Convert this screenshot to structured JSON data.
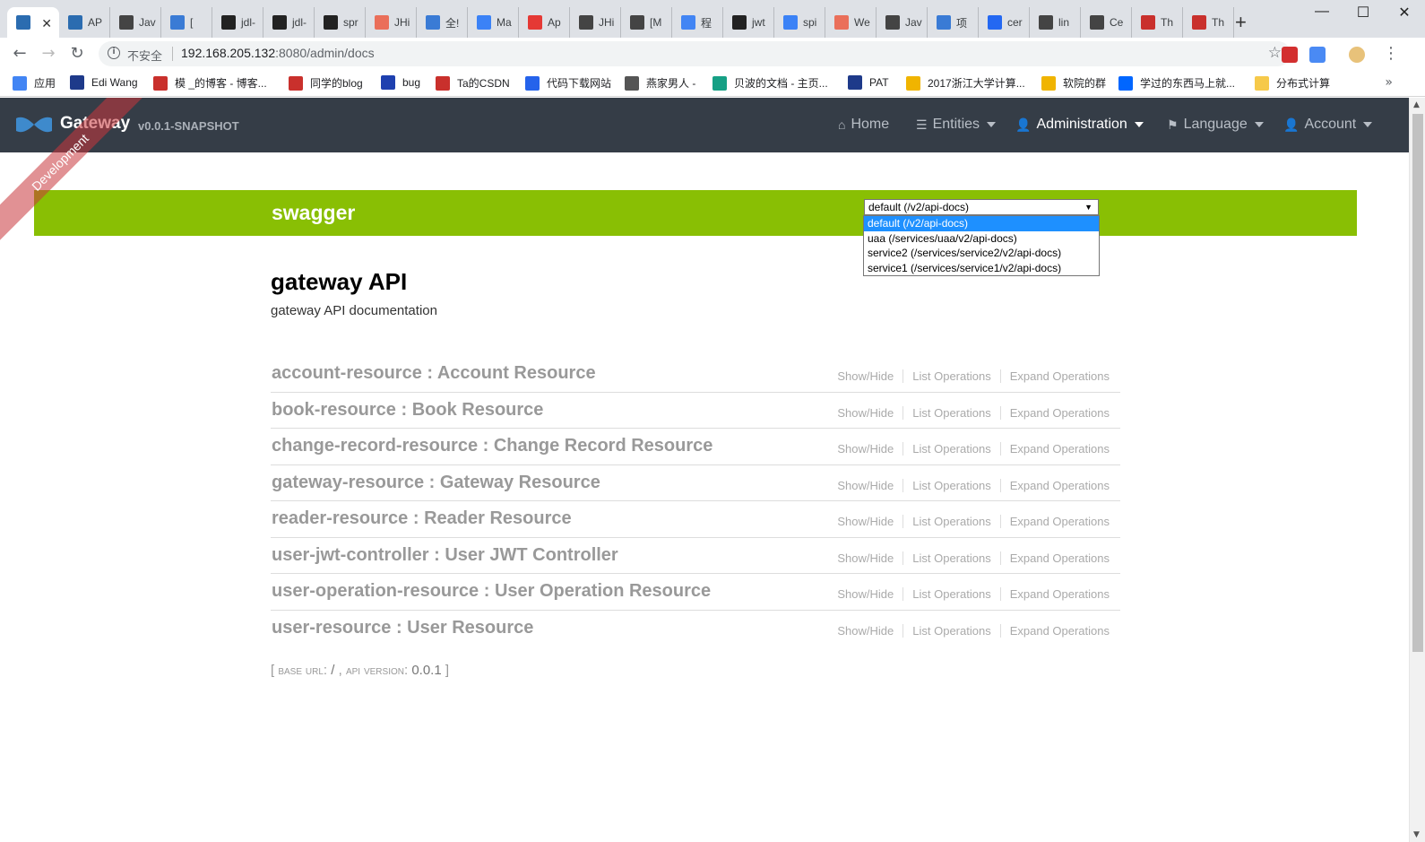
{
  "browser": {
    "tabs": [
      {
        "title": "",
        "favicon": "jhipster-icon",
        "color": "#2b6cb0",
        "active": true
      },
      {
        "title": "AP",
        "favicon": "jhipster-icon",
        "color": "#2b6cb0"
      },
      {
        "title": "Jav",
        "favicon": "tophat-icon",
        "color": "#444444"
      },
      {
        "title": "[",
        "favicon": "square-icon",
        "color": "#3a7bd5"
      },
      {
        "title": "jdl-",
        "favicon": "github-icon",
        "color": "#222222"
      },
      {
        "title": "jdl-",
        "favicon": "github-icon",
        "color": "#222222"
      },
      {
        "title": "spr",
        "favicon": "github-icon",
        "color": "#222222"
      },
      {
        "title": "JHi",
        "favicon": "jianshu-icon",
        "color": "#ea6f5a"
      },
      {
        "title": "全!",
        "favicon": "square-icon",
        "color": "#3a7bd5"
      },
      {
        "title": "Ma",
        "favicon": "stack-icon",
        "color": "#3b82f6"
      },
      {
        "title": "Ap",
        "favicon": "owl-icon",
        "color": "#e53935"
      },
      {
        "title": "JHi",
        "favicon": "tophat-icon",
        "color": "#444444"
      },
      {
        "title": "[M",
        "favicon": "tophat-icon",
        "color": "#444444"
      },
      {
        "title": "程",
        "favicon": "google-icon",
        "color": "#4285f4"
      },
      {
        "title": "jwt",
        "favicon": "github-icon",
        "color": "#222222"
      },
      {
        "title": "spi",
        "favicon": "stack-icon",
        "color": "#3b82f6"
      },
      {
        "title": "We",
        "favicon": "jianshu-icon",
        "color": "#ea6f5a"
      },
      {
        "title": "Jav",
        "favicon": "tophat-icon",
        "color": "#444444"
      },
      {
        "title": "项",
        "favicon": "square-icon",
        "color": "#3a7bd5"
      },
      {
        "title": "cer",
        "favicon": "paw-icon",
        "color": "#2468f2"
      },
      {
        "title": "lin",
        "favicon": "tophat-icon",
        "color": "#444444"
      },
      {
        "title": "Ce",
        "favicon": "tophat-icon",
        "color": "#444444"
      },
      {
        "title": "Th",
        "favicon": "csdn-icon",
        "color": "#c9302c"
      },
      {
        "title": "Th",
        "favicon": "csdn-icon",
        "color": "#c9302c"
      }
    ],
    "new_tab": "+",
    "window_controls": {
      "minimize": "—",
      "maximize": "☐",
      "close": "✕"
    },
    "address": {
      "security_label": "不安全",
      "url_host": "192.168.205.132",
      "url_rest": ":8080/admin/docs"
    },
    "bookmarks": [
      {
        "label": "应用",
        "icon": "apps-grid-icon",
        "color": "#4285f4"
      },
      {
        "label": "Edi Wang",
        "icon": "edi-icon",
        "color": "#1e3a8a"
      },
      {
        "label": "模 _的博客 - 博客...",
        "icon": "csdn-icon",
        "color": "#c9302c"
      },
      {
        "label": "同学的blog",
        "icon": "csdn-icon",
        "color": "#c9302c"
      },
      {
        "label": "bug",
        "icon": "bug-icon",
        "color": "#1e40af"
      },
      {
        "label": "Ta的CSDN",
        "icon": "csdn-icon",
        "color": "#c9302c"
      },
      {
        "label": "代码下载网站",
        "icon": "u-icon",
        "color": "#2563eb"
      },
      {
        "label": "燕家男人 -",
        "icon": "globe-icon",
        "color": "#555555"
      },
      {
        "label": "贝波的文档 - 主页...",
        "icon": "doc-icon",
        "color": "#16a085"
      },
      {
        "label": "PAT",
        "icon": "pat-icon",
        "color": "#1e3a8a"
      },
      {
        "label": "2017浙江大学计算...",
        "icon": "trophy-icon",
        "color": "#f0b400"
      },
      {
        "label": "软院的群",
        "icon": "trophy-icon",
        "color": "#f0b400"
      },
      {
        "label": "学过的东西马上就...",
        "icon": "zhihu-icon",
        "color": "#0066ff"
      },
      {
        "label": "分布式计算",
        "icon": "folder-icon",
        "color": "#f6c94a"
      }
    ],
    "bookmarks_more": "»"
  },
  "navbar": {
    "brand": "Gateway",
    "version": "v0.0.1-SNAPSHOT",
    "ribbon": "Development",
    "items": [
      {
        "label": "Home",
        "icon": "home-icon",
        "glyph": "⌂",
        "dropdown": false,
        "active": false
      },
      {
        "label": "Entities",
        "icon": "list-icon",
        "glyph": "☰",
        "dropdown": true,
        "active": false
      },
      {
        "label": "Administration",
        "icon": "user-plus-icon",
        "glyph": "👤",
        "dropdown": true,
        "active": true
      },
      {
        "label": "Language",
        "icon": "flag-icon",
        "glyph": "⚑",
        "dropdown": true,
        "active": false
      },
      {
        "label": "Account",
        "icon": "user-icon",
        "glyph": "👤",
        "dropdown": true,
        "active": false
      }
    ]
  },
  "swagger": {
    "title": "swagger",
    "selected_api": "default (/v2/api-docs)",
    "options": [
      "default (/v2/api-docs)",
      "uaa (/services/uaa/v2/api-docs)",
      "service2 (/services/service2/v2/api-docs)",
      "service1 (/services/service1/v2/api-docs)"
    ],
    "accent_color": "#89bf04"
  },
  "api": {
    "title": "gateway API",
    "description": "gateway API documentation",
    "resources": [
      "account-resource : Account Resource",
      "book-resource : Book Resource",
      "change-record-resource : Change Record Resource",
      "gateway-resource : Gateway Resource",
      "reader-resource : Reader Resource",
      "user-jwt-controller : User JWT Controller",
      "user-operation-resource : User Operation Resource",
      "user-resource : User Resource"
    ],
    "operations": [
      "Show/Hide",
      "List Operations",
      "Expand Operations"
    ],
    "footer": {
      "open": "[",
      "base_url_label": "base url",
      "base_url": "/",
      "api_version_label": "api version",
      "api_version": "0.0.1",
      "close": "]"
    }
  }
}
